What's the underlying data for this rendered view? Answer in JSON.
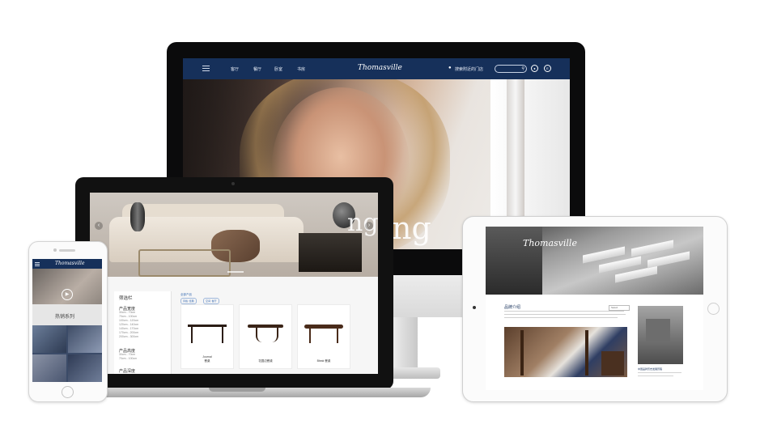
{
  "imac": {
    "logo": "Thomasville",
    "nav_items": [
      "客厅",
      "餐厅",
      "卧室",
      "书房"
    ],
    "store_locator": "搜索附近的门店",
    "hero_headline": "ng"
  },
  "laptop": {
    "hero_word": "ng",
    "filter_title": "筛选栏",
    "crumb": "全部产品",
    "pills": [
      "风格: 经典",
      "空间: 餐厅"
    ],
    "filter_groups": [
      {
        "title": "产品宽度",
        "options": [
          "30cm - 70cm",
          "70cm - 100cm",
          "100cm - 120cm",
          "120cm - 140cm",
          "140cm - 170cm",
          "170cm - 200cm",
          "200cm - 300cm"
        ]
      },
      {
        "title": "产品高度",
        "options": [
          "30cm - 70cm",
          "70cm - 100cm"
        ]
      },
      {
        "title": "产品深度",
        "options": []
      }
    ],
    "products": [
      {
        "name_line1": "Journal",
        "name_line2": "餐桌"
      },
      {
        "name_line1": "",
        "name_line2": "花园边餐桌"
      },
      {
        "name_line1": "",
        "name_line2": "Bleak 餐桌"
      }
    ]
  },
  "phone": {
    "logo": "Thomasville",
    "section_title": "热销系列"
  },
  "ipad": {
    "logo": "Thomasville",
    "section_title": "品牌介绍",
    "select_value": "Select",
    "side_caption": "中国品牌历史发展历程"
  },
  "colors": {
    "navy": "#16305a",
    "accent_blue": "#3b6db3"
  }
}
